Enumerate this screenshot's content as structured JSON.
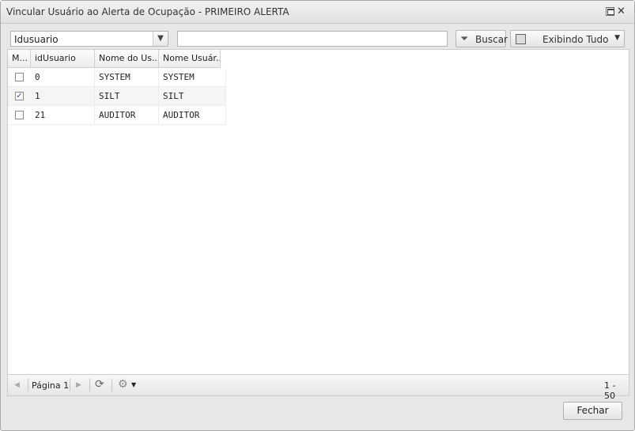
{
  "window": {
    "title": "Vincular Usuário ao Alerta de Ocupação - PRIMEIRO ALERTA",
    "close_glyph": "✕"
  },
  "toolbar": {
    "field_select_value": "Idusuario",
    "search_value": "",
    "search_button": "Buscar",
    "filter_button": "Exibindo Tudo"
  },
  "table": {
    "columns": [
      "M...",
      "idUsuario",
      "Nome do Us...",
      "Nome Usuár..."
    ],
    "rows": [
      {
        "checked": false,
        "id": "0",
        "nome": "SYSTEM",
        "usuario": "SYSTEM"
      },
      {
        "checked": true,
        "id": "1",
        "nome": "SILT",
        "usuario": "SILT"
      },
      {
        "checked": false,
        "id": "21",
        "nome": "AUDITOR",
        "usuario": "AUDITOR"
      }
    ]
  },
  "pager": {
    "page_label": "Página 1",
    "range": "1 - 50"
  },
  "footer": {
    "close_button": "Fechar"
  },
  "icons": {
    "prev": "◀",
    "next": "▶",
    "refresh": "⟳",
    "settings": "⚙"
  }
}
